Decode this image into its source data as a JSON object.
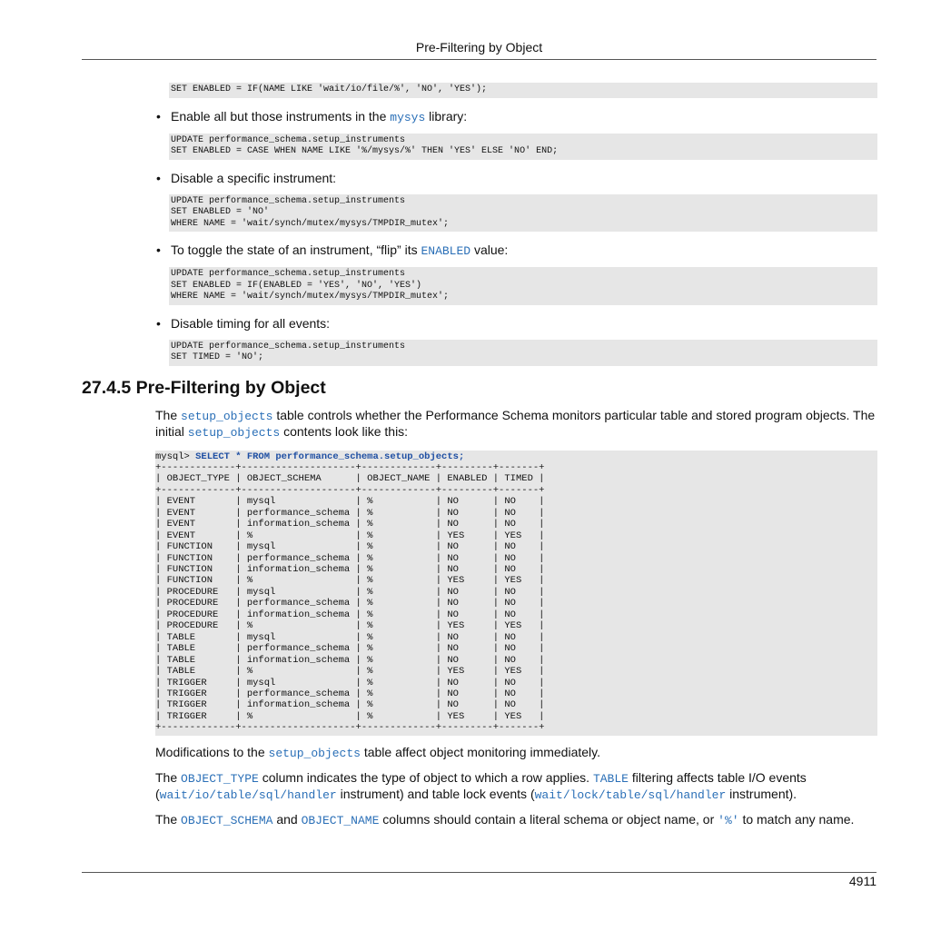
{
  "header": {
    "title": "Pre-Filtering by Object"
  },
  "blocks": {
    "code0": "SET ENABLED = IF(NAME LIKE 'wait/io/file/%', 'NO', 'YES');",
    "bullet1": {
      "before": "Enable all but those instruments in the ",
      "code": "mysys",
      "after": " library:"
    },
    "code1": "UPDATE performance_schema.setup_instruments\nSET ENABLED = CASE WHEN NAME LIKE '%/mysys/%' THEN 'YES' ELSE 'NO' END;",
    "bullet2": {
      "text": "Disable a specific instrument:"
    },
    "code2": "UPDATE performance_schema.setup_instruments\nSET ENABLED = 'NO'\nWHERE NAME = 'wait/synch/mutex/mysys/TMPDIR_mutex';",
    "bullet3": {
      "before": "To toggle the state of an instrument, “flip” its ",
      "code": "ENABLED",
      "after": " value:"
    },
    "code3": "UPDATE performance_schema.setup_instruments\nSET ENABLED = IF(ENABLED = 'YES', 'NO', 'YES')\nWHERE NAME = 'wait/synch/mutex/mysys/TMPDIR_mutex';",
    "bullet4": {
      "text": "Disable timing for all events:"
    },
    "code4": "UPDATE performance_schema.setup_instruments\nSET TIMED = 'NO';"
  },
  "section": {
    "title": "27.4.5 Pre-Filtering by Object",
    "p1": {
      "a": "The ",
      "c1": "setup_objects",
      "b": " table controls whether the Performance Schema monitors particular table and stored program objects. The initial ",
      "c2": "setup_objects",
      "d": " contents look like this:"
    },
    "query": {
      "prompt": "mysql> ",
      "statement": "SELECT * FROM performance_schema.setup_objects;",
      "separator": "+-------------+--------------------+-------------+---------+-------+",
      "header": "| OBJECT_TYPE | OBJECT_SCHEMA      | OBJECT_NAME | ENABLED | TIMED |",
      "rows": [
        "| EVENT       | mysql              | %           | NO      | NO    |",
        "| EVENT       | performance_schema | %           | NO      | NO    |",
        "| EVENT       | information_schema | %           | NO      | NO    |",
        "| EVENT       | %                  | %           | YES     | YES   |",
        "| FUNCTION    | mysql              | %           | NO      | NO    |",
        "| FUNCTION    | performance_schema | %           | NO      | NO    |",
        "| FUNCTION    | information_schema | %           | NO      | NO    |",
        "| FUNCTION    | %                  | %           | YES     | YES   |",
        "| PROCEDURE   | mysql              | %           | NO      | NO    |",
        "| PROCEDURE   | performance_schema | %           | NO      | NO    |",
        "| PROCEDURE   | information_schema | %           | NO      | NO    |",
        "| PROCEDURE   | %                  | %           | YES     | YES   |",
        "| TABLE       | mysql              | %           | NO      | NO    |",
        "| TABLE       | performance_schema | %           | NO      | NO    |",
        "| TABLE       | information_schema | %           | NO      | NO    |",
        "| TABLE       | %                  | %           | YES     | YES   |",
        "| TRIGGER     | mysql              | %           | NO      | NO    |",
        "| TRIGGER     | performance_schema | %           | NO      | NO    |",
        "| TRIGGER     | information_schema | %           | NO      | NO    |",
        "| TRIGGER     | %                  | %           | YES     | YES   |"
      ]
    },
    "p2": {
      "a": "Modifications to the ",
      "c1": "setup_objects",
      "b": " table affect object monitoring immediately."
    },
    "p3": {
      "a": "The ",
      "c1": "OBJECT_TYPE",
      "b": " column indicates the type of object to which a row applies. ",
      "c2": "TABLE",
      "c": " filtering affects table I/O events (",
      "c3": "wait/io/table/sql/handler",
      "d": " instrument) and table lock events (",
      "c4": "wait/lock/table/sql/handler",
      "e": " instrument)."
    },
    "p4": {
      "a": "The ",
      "c1": "OBJECT_SCHEMA",
      "b": " and ",
      "c2": "OBJECT_NAME",
      "c": " columns should contain a literal schema or object name, or ",
      "c3": "'%'",
      "d": " to match any name."
    }
  },
  "footer": {
    "page_number": "4911"
  }
}
